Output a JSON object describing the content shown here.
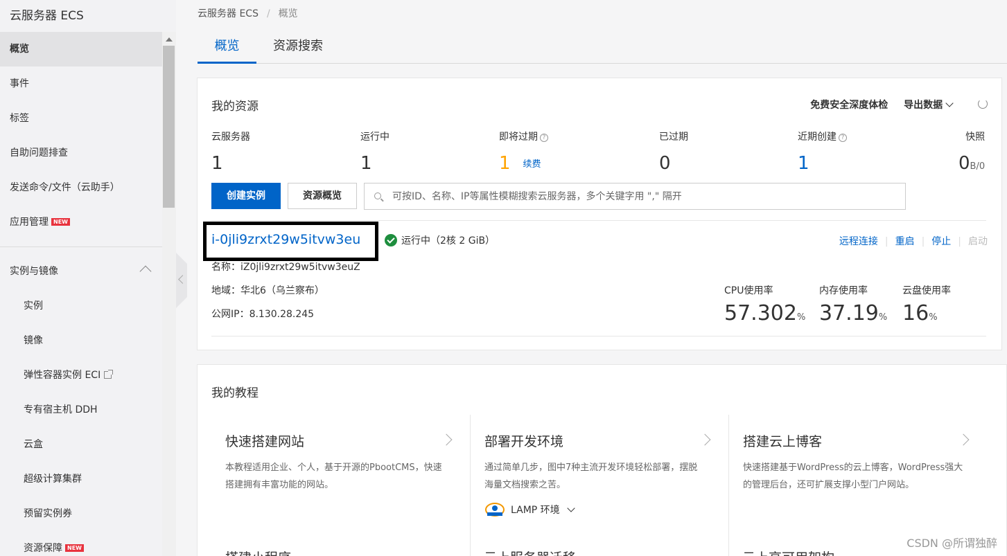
{
  "sidebar": {
    "title": "云服务器 ECS",
    "items": [
      {
        "label": "概览"
      },
      {
        "label": "事件"
      },
      {
        "label": "标签"
      },
      {
        "label": "自助问题排查"
      },
      {
        "label": "发送命令/文件（云助手）"
      },
      {
        "label": "应用管理",
        "badge": "NEW"
      }
    ],
    "group": {
      "label": "实例与镜像"
    },
    "sub_items": [
      {
        "label": "实例"
      },
      {
        "label": "镜像"
      },
      {
        "label": "弹性容器实例 ECI"
      },
      {
        "label": "专有宿主机 DDH"
      },
      {
        "label": "云盒"
      },
      {
        "label": "超级计算集群"
      },
      {
        "label": "预留实例券"
      },
      {
        "label": "资源保障",
        "badge": "NEW"
      }
    ]
  },
  "breadcrumb": {
    "root": "云服务器 ECS",
    "sep": "/",
    "current": "概览"
  },
  "tabs": [
    {
      "label": "概览"
    },
    {
      "label": "资源搜索"
    }
  ],
  "resources": {
    "title": "我的资源",
    "actions": {
      "security": "免费安全深度体检",
      "export": "导出数据"
    },
    "stats": [
      {
        "label": "云服务器",
        "value": "1"
      },
      {
        "label": "运行中",
        "value": "1"
      },
      {
        "label": "即将过期",
        "value": "1",
        "link": "续费"
      },
      {
        "label": "已过期",
        "value": "0"
      },
      {
        "label": "近期创建",
        "value": "1"
      },
      {
        "label": "快照",
        "value": "0",
        "unit": "B/0"
      }
    ],
    "create_button": "创建实例",
    "overview_button": "资源概览",
    "search_placeholder": "可按ID、名称、IP等属性模糊搜索云服务器，多个关键字用 \",\" 隔开",
    "instance": {
      "id": "i-0jli9zrxt29w5itvw3eu",
      "status": "运行中",
      "spec": "（2核 2 GiB）",
      "name": "名称：iZ0jli9zrxt29w5itvw3euZ",
      "region": "地域：华北6（乌兰察布）",
      "ip": "公网IP：8.130.28.245",
      "actions": {
        "remote": "远程连接",
        "restart": "重启",
        "stop": "停止",
        "start": "启动"
      },
      "metrics": [
        {
          "label": "CPU使用率",
          "value": "57.302",
          "unit": "%"
        },
        {
          "label": "内存使用率",
          "value": "37.19",
          "unit": "%"
        },
        {
          "label": "云盘使用率",
          "value": "16",
          "unit": "%"
        }
      ]
    }
  },
  "tutorials": {
    "title": "我的教程",
    "items": [
      {
        "title": "快速搭建网站",
        "desc": "本教程适用企业、个人，基于开源的PbootCMS，快速搭建拥有丰富功能的网站。"
      },
      {
        "title": "部署开发环境",
        "desc": "通过简单几步，图中7种主流开发环境轻松部署，摆脱海量文档搜索之苦。",
        "select": "LAMP 环境"
      },
      {
        "title": "搭建云上博客",
        "desc": "快速搭建基于WordPress的云上博客，WordPress强大的管理后台，还可扩展支撑小型门户网站。"
      }
    ],
    "row2": [
      "搭建小程序",
      "云上服务器迁移",
      "云上高可用架构"
    ]
  },
  "watermark": "CSDN @所谓独醉"
}
